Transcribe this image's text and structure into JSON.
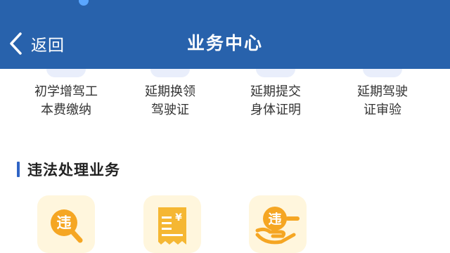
{
  "header": {
    "back_label": "返回",
    "title": "业务中心"
  },
  "top_services": [
    {
      "label": "初学增驾工\n本费缴纳"
    },
    {
      "label": "延期换领\n驾驶证"
    },
    {
      "label": "延期提交\n身体证明"
    },
    {
      "label": "延期驾驶\n证审验"
    }
  ],
  "section": {
    "title": "违法处理业务"
  },
  "violation_tiles": [
    {
      "icon": "violation-search-icon",
      "glyph": "违"
    },
    {
      "icon": "receipt-yen-icon",
      "glyph": "¥"
    },
    {
      "icon": "violation-hand-icon",
      "glyph": "违"
    }
  ],
  "colors": {
    "header_bg": "#2862ac",
    "accent_blue": "#2f64c5",
    "tile_bg": "#fff6dd",
    "icon_orange": "#f5a623"
  }
}
